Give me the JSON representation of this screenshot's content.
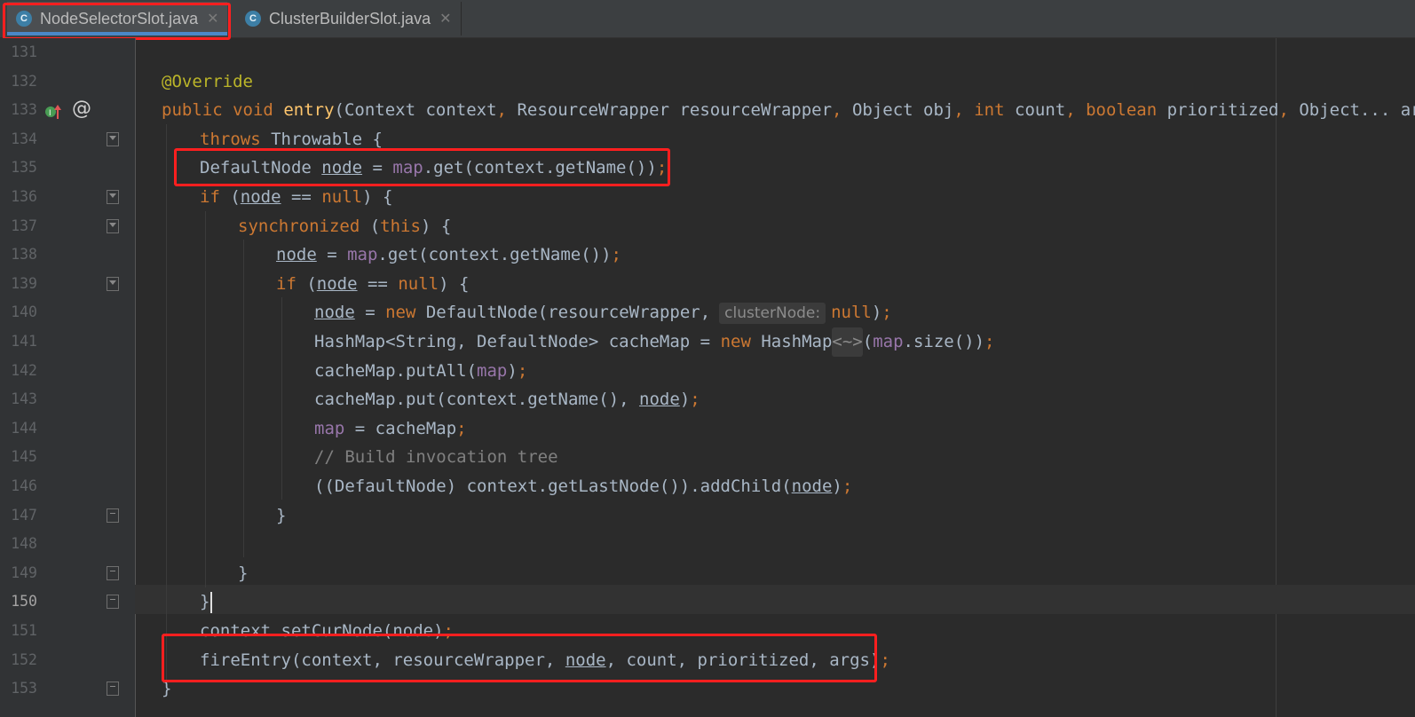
{
  "tabs": [
    {
      "label": "NodeSelectorSlot.java",
      "icon": "class-icon",
      "icon_letter": "C",
      "close": "✕",
      "active": true
    },
    {
      "label": "ClusterBuilderSlot.java",
      "icon": "class-icon",
      "icon_letter": "C",
      "close": "✕",
      "active": false
    }
  ],
  "gutter": {
    "override_marker": "@"
  },
  "current_line": 150,
  "line_numbers": [
    "131",
    "132",
    "133",
    "134",
    "135",
    "136",
    "137",
    "138",
    "139",
    "140",
    "141",
    "142",
    "143",
    "144",
    "145",
    "146",
    "147",
    "148",
    "149",
    "150",
    "151",
    "152",
    "153"
  ],
  "code": {
    "l132_annotation": "@Override",
    "l133": {
      "kw1": "public",
      "kw2": "void",
      "fn": "entry",
      "p1": "(Context context",
      "c1": ",",
      "p2": " ResourceWrapper resourceWrapper",
      "c2": ",",
      "p3": " Object obj",
      "c3": ",",
      "kw3": " int",
      "p4": " count",
      "c4": ",",
      "kw4": " boolean",
      "p5": " prioritized",
      "c5": ",",
      "p6": " Object... args)"
    },
    "l134": {
      "kw": "throws",
      "rest": " Throwable {"
    },
    "l135": {
      "a": "DefaultNode ",
      "v": "node",
      "b": " = ",
      "f": "map",
      "c": ".get(context.getName())",
      "s": ";"
    },
    "l136": {
      "kw": "if",
      "a": " (",
      "v": "node",
      "b": " == ",
      "kw2": "null",
      "c": ") {"
    },
    "l137": {
      "kw": "synchronized",
      "a": " (",
      "kw2": "this",
      "b": ") {"
    },
    "l138": {
      "v": "node",
      "a": " = ",
      "f": "map",
      "b": ".get(context.getName())",
      "s": ";"
    },
    "l139": {
      "kw": "if",
      "a": " (",
      "v": "node",
      "b": " == ",
      "kw2": "null",
      "c": ") {"
    },
    "l140": {
      "v": "node",
      "a": " = ",
      "kw": "new",
      "b": " DefaultNode(resourceWrapper,",
      "hint": "clusterNode:",
      "kw2": "null",
      "c": ")",
      "s": ";"
    },
    "l141": {
      "a": "HashMap<String, DefaultNode> cacheMap = ",
      "kw": "new",
      "b": " HashMap",
      "d": "<~>",
      "c": "(",
      "f": "map",
      "e": ".size())",
      "s": ";"
    },
    "l142": {
      "a": "cacheMap.putAll(",
      "f": "map",
      "b": ")",
      "s": ";"
    },
    "l143": {
      "a": "cacheMap.put(context.getName(), ",
      "v": "node",
      "b": ")",
      "s": ";"
    },
    "l144": {
      "f": "map",
      "a": " = cacheMap",
      "s": ";"
    },
    "l145": {
      "cm": "// Build invocation tree"
    },
    "l146": {
      "a": "((DefaultNode) context.getLastNode()).addChild(",
      "v": "node",
      "b": ")",
      "s": ";"
    },
    "l147": {
      "a": "}"
    },
    "l149": {
      "a": "}"
    },
    "l150": {
      "a": "}"
    },
    "l151": {
      "a": "context.setCurNode(node)",
      "s": ";"
    },
    "l152": {
      "a": "fireEntry(context, resourceWrapper, ",
      "v": "node",
      "b": ", count, prioritized, args)",
      "s": ";"
    },
    "l153": {
      "a": "}"
    }
  },
  "colors": {
    "background": "#2b2b2b",
    "keyword": "#cc7832",
    "annotation": "#bbb529",
    "method": "#ffc66d",
    "field": "#9876aa",
    "highlight_box": "#ff1f1f"
  }
}
